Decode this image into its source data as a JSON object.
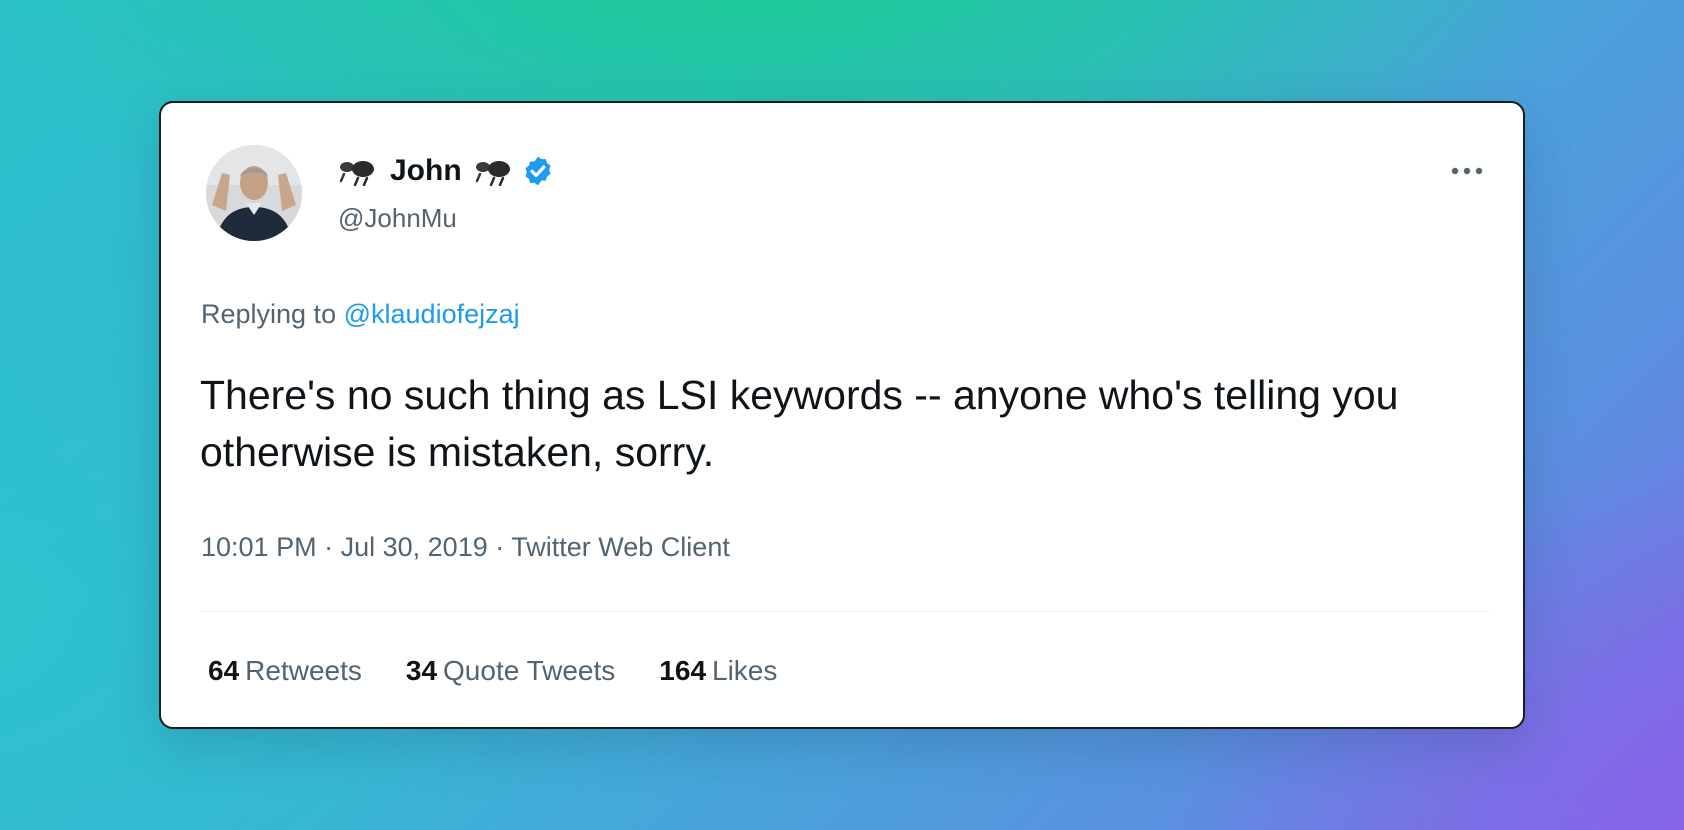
{
  "tweet": {
    "author": {
      "display_name": "John",
      "handle": "@JohnMu",
      "verified": true,
      "name_emoji": "cloud-rain-icon"
    },
    "replying_to": {
      "prefix": "Replying to",
      "handle": "@klaudiofejzaj"
    },
    "text": "There's no such thing as LSI keywords -- anyone who's telling you otherwise is mistaken, sorry.",
    "time": "10:01 PM",
    "date": "Jul 30, 2019",
    "separator": "·",
    "source": "Twitter Web Client",
    "stats": [
      {
        "count": "64",
        "label": "Retweets"
      },
      {
        "count": "34",
        "label": "Quote Tweets"
      },
      {
        "count": "164",
        "label": "Likes"
      }
    ]
  },
  "colors": {
    "text_primary": "#0f1419",
    "text_secondary": "#536471",
    "link": "#1d9bf0",
    "verified_badge": "#1d9bf0"
  },
  "icons": {
    "more": "more-horizontal-icon",
    "verified": "verified-badge-icon"
  }
}
